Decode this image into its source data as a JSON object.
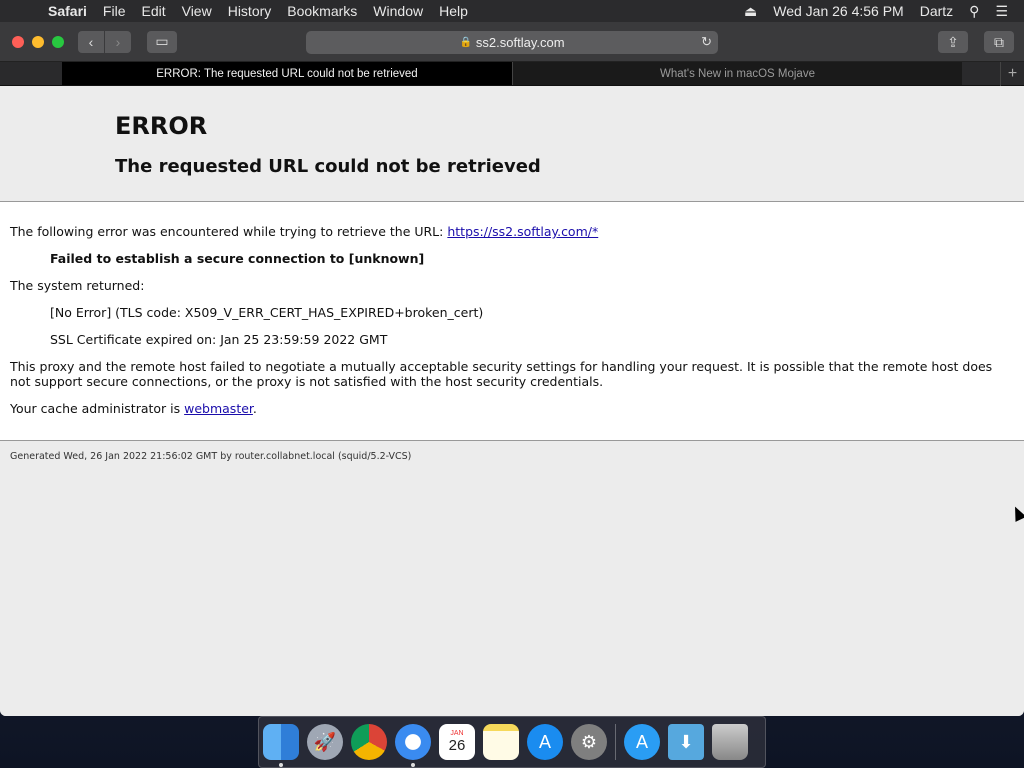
{
  "menubar": {
    "app": "Safari",
    "items": [
      "File",
      "Edit",
      "View",
      "History",
      "Bookmarks",
      "Window",
      "Help"
    ],
    "datetime": "Wed Jan 26  4:56 PM",
    "user": "Dartz"
  },
  "toolbar": {
    "address": "ss2.softlay.com"
  },
  "tabs": [
    {
      "label": "ERROR: The requested URL could not be retrieved",
      "active": true
    },
    {
      "label": "What's New in macOS Mojave",
      "active": false
    }
  ],
  "page": {
    "title": "ERROR",
    "subtitle": "The requested URL could not be retrieved",
    "intro": "The following error was encountered while trying to retrieve the URL: ",
    "url": "https://ss2.softlay.com/*",
    "failure": "Failed to establish a secure connection to [unknown]",
    "system_returned": "The system returned:",
    "no_error": "[No Error] (TLS code: X509_V_ERR_CERT_HAS_EXPIRED+broken_cert)",
    "ssl_expired": "SSL Certificate expired on: Jan 25 23:59:59 2022 GMT",
    "explanation": "This proxy and the remote host failed to negotiate a mutually acceptable security settings for handling your request. It is possible that the remote host does not support secure connections, or the proxy is not satisfied with the host security credentials.",
    "admin_prefix": "Your cache administrator is ",
    "admin_link": "webmaster",
    "admin_suffix": ".",
    "footer": "Generated Wed, 26 Jan 2022 21:56:02 GMT by router.collabnet.local (squid/5.2-VCS)"
  },
  "dock": {
    "calendar_month": "JAN",
    "calendar_day": "26"
  }
}
